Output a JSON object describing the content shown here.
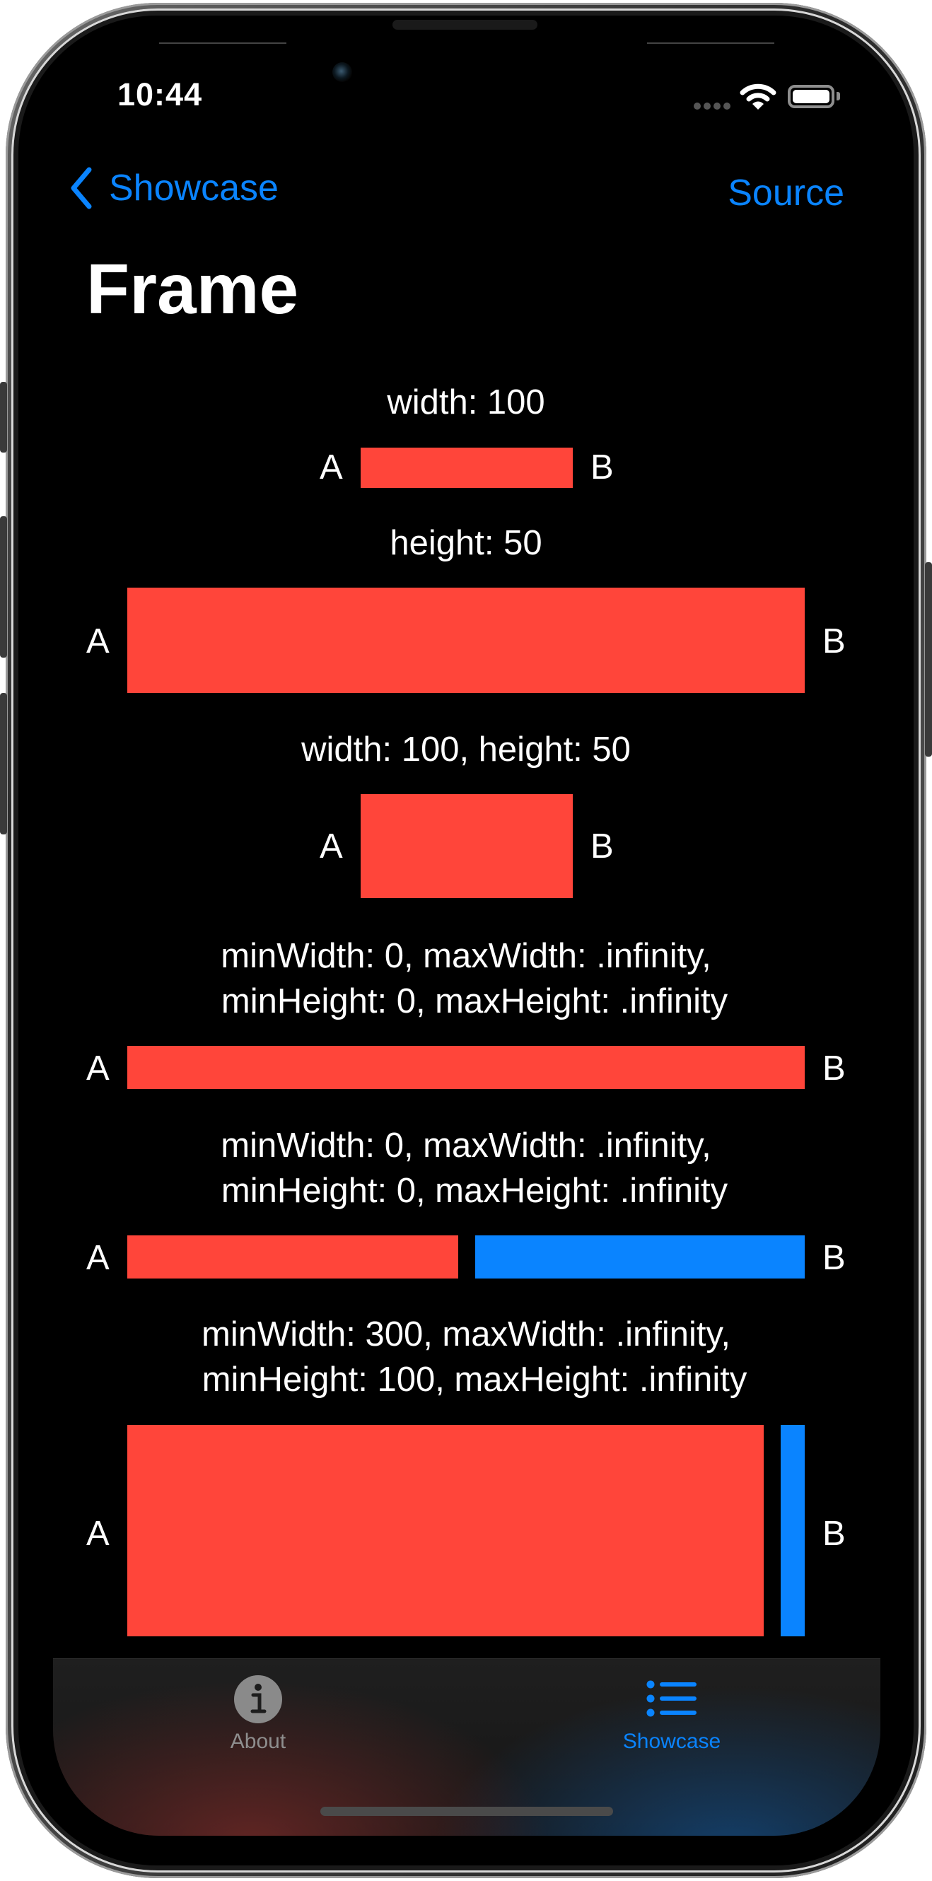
{
  "status_bar": {
    "time": "10:44",
    "signal_icon": "cellular-signal-icon",
    "wifi_icon": "wifi-icon",
    "battery_icon": "battery-full-icon"
  },
  "nav": {
    "back_icon": "chevron-left-icon",
    "back_label": "Showcase",
    "right_action": "Source",
    "title": "Frame"
  },
  "colors": {
    "accent": "#0a84ff",
    "red": "#ff453a",
    "blue": "#0a84ff",
    "background": "#000000"
  },
  "examples": [
    {
      "label": "width: 100",
      "left": "A",
      "right": "B"
    },
    {
      "label": "height: 50",
      "left": "A",
      "right": "B"
    },
    {
      "label": "width: 100, height: 50",
      "left": "A",
      "right": "B"
    },
    {
      "label_line1": "minWidth: 0, maxWidth: .infinity,",
      "label_line2": "minHeight: 0, maxHeight: .infinity",
      "left": "A",
      "right": "B"
    },
    {
      "label_line1": "minWidth: 0, maxWidth: .infinity,",
      "label_line2": "minHeight: 0, maxHeight: .infinity",
      "left": "A",
      "right": "B"
    },
    {
      "label_line1": "minWidth: 300, maxWidth: .infinity,",
      "label_line2": "minHeight: 100, maxHeight: .infinity",
      "left": "A",
      "right": "B"
    }
  ],
  "tabbar": {
    "tabs": [
      {
        "label": "About",
        "icon": "info-circle-icon",
        "selected": false
      },
      {
        "label": "Showcase",
        "icon": "list-bullet-icon",
        "selected": true
      }
    ]
  }
}
